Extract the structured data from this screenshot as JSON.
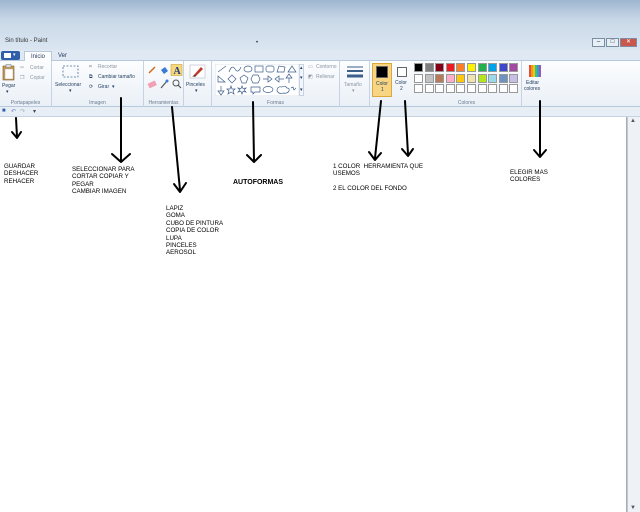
{
  "window": {
    "title": "Sin título - Paint",
    "minimize": "–",
    "maximize": "□",
    "close": "✕"
  },
  "tabs": [
    "Inicio",
    "Ver"
  ],
  "ribbon": {
    "portapapeles": {
      "label": "Portapapeles",
      "paste": "Pegar",
      "cut": "Cortar",
      "copy": "Copiar"
    },
    "imagen": {
      "label": "Imagen",
      "select": "Seleccionar",
      "crop": "Recortar",
      "resize": "Cambiar tamaño",
      "rotate": "Girar"
    },
    "herramientas": {
      "label": "Herramientas"
    },
    "pinceles": {
      "label": "Pinceles"
    },
    "formas": {
      "label": "Formas",
      "outline": "Contorno",
      "fill": "Rellenar"
    },
    "tamano": {
      "label": "Tamaño"
    },
    "color1": {
      "label": "Color",
      "sub": "1",
      "value": "#000000"
    },
    "color2": {
      "label": "Color",
      "sub": "2",
      "value": "#ffffff"
    },
    "colores": {
      "label": "Colores",
      "edit": "Editar",
      "edit2": "colores",
      "palette": [
        "#000000",
        "#7f7f7f",
        "#880015",
        "#ed1c24",
        "#ff7f27",
        "#fff200",
        "#22b14c",
        "#00a2e8",
        "#3f48cc",
        "#a349a4",
        "#ffffff",
        "#c3c3c3",
        "#b97a57",
        "#ffaec9",
        "#ffc90e",
        "#efe4b0",
        "#b5e61d",
        "#99d9ea",
        "#7092be",
        "#c8bfe7",
        "#ffffff",
        "#ffffff",
        "#ffffff",
        "#ffffff",
        "#ffffff",
        "#ffffff",
        "#ffffff",
        "#ffffff",
        "#ffffff",
        "#ffffff"
      ]
    }
  },
  "annotations": {
    "guardar": "GUARDAR\nDESHACER\nREHACER",
    "seleccionar": "SELECCIONAR PARA\nCORTAR COPIAR Y\nPEGAR\nCAMBIAR IMAGEN",
    "herramientas": "LAPIZ\nGOMA\nCUBO DE PINTURA\nCOPIA DE COLOR\nLUPA\nPINCELES\nAEROSOL",
    "autoformas": "AUTOFORMAS",
    "color": "1 COLOR  HERRAMIENTA QUE\nUSEMOS\n\n2 EL COLOR DEL FONDO",
    "elegir": "ELEGIR MAS\nCOLORES"
  }
}
